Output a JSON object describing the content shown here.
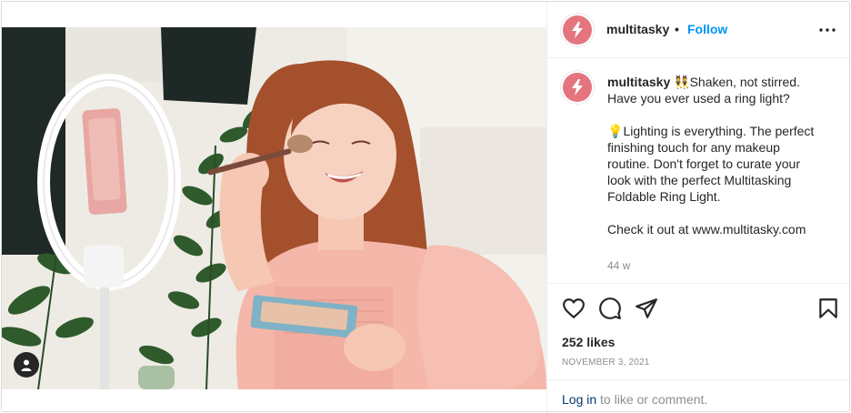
{
  "post": {
    "username": "multitasky",
    "follow_label": "Follow",
    "separator": "•",
    "caption": {
      "username": "multitasky",
      "line1_emoji": "👯",
      "line1": "Shaken, not stirred. Have you ever used a ring light?",
      "line2_emoji": "💡",
      "line2": "Lighting is everything. The perfect finishing touch for any makeup routine. Don't forget to curate your look with the perfect Multitasking Foldable Ring Light.",
      "line3_emoji": "",
      "line3": "Check it out at www.multitasky.com"
    },
    "time_ago": "44 w",
    "likes": "252 likes",
    "date": "NOVEMBER 3, 2021",
    "footer": {
      "login_label": "Log in",
      "rest": " to like or comment."
    }
  },
  "icons": {
    "avatar": "lightning-bolt-icon",
    "more": "more-options-icon",
    "like": "heart-icon",
    "comment": "comment-icon",
    "share": "share-icon",
    "save": "bookmark-icon",
    "tags": "user-tag-icon"
  },
  "colors": {
    "brand_avatar": "#e4757f",
    "follow": "#0095f6",
    "link": "#00376b",
    "muted": "#8e8e8e"
  }
}
